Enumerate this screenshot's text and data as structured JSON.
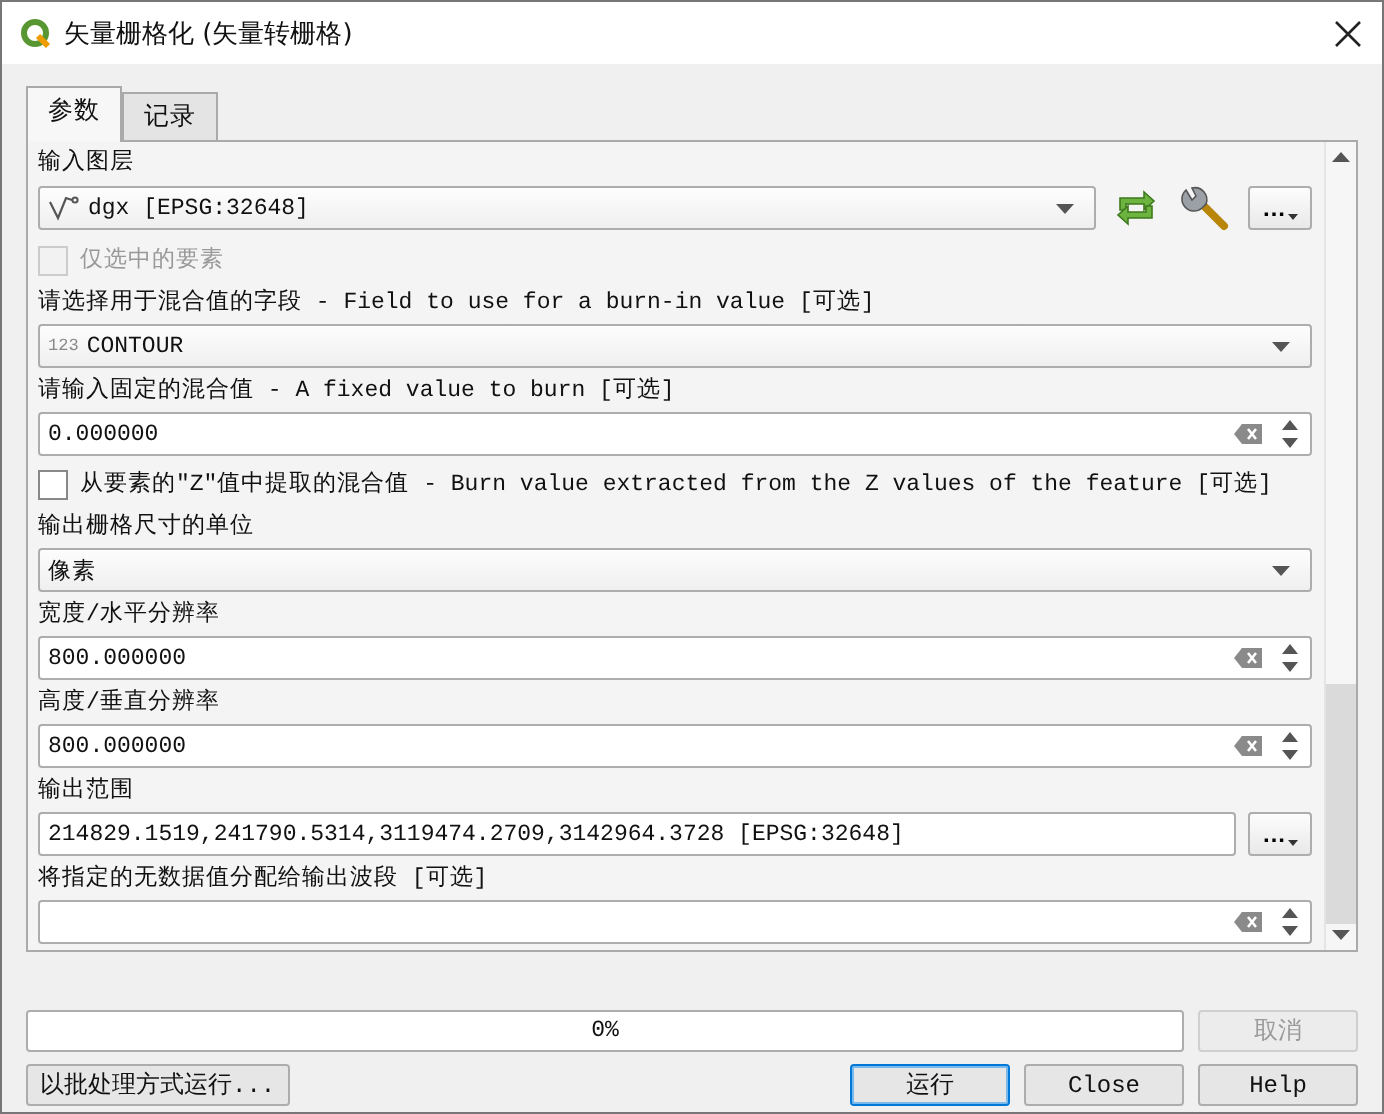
{
  "window": {
    "title": "矢量栅格化 (矢量转栅格)"
  },
  "tabs": [
    {
      "label": "参数",
      "selected": true
    },
    {
      "label": "记录",
      "selected": false
    }
  ],
  "params": [
    {
      "kind": "layer",
      "label": "输入图层",
      "value": "dgx [EPSG:32648]",
      "more": "…"
    },
    {
      "kind": "checkbox",
      "label": "仅选中的要素",
      "checked": false,
      "disabled": true
    },
    {
      "kind": "field",
      "label": "请选择用于混合值的字段 - Field to use for a burn-in value [可选]",
      "type_tag": "123",
      "value": "CONTOUR"
    },
    {
      "kind": "number",
      "label": "请输入固定的混合值 - A fixed value to burn [可选]",
      "value": "0.000000"
    },
    {
      "kind": "checkbox",
      "label": "从要素的\"Z\"值中提取的混合值 - Burn value extracted from the Z values of the feature [可选]",
      "checked": false,
      "disabled": false
    },
    {
      "kind": "select",
      "label": "输出栅格尺寸的单位",
      "value": "像素"
    },
    {
      "kind": "number",
      "label": "宽度/水平分辨率",
      "value": "800.000000"
    },
    {
      "kind": "number",
      "label": "高度/垂直分辨率",
      "value": "800.000000"
    },
    {
      "kind": "extent",
      "label": "输出范围",
      "value": "214829.1519,241790.5314,3119474.2709,3142964.3728 [EPSG:32648]",
      "more": "…"
    },
    {
      "kind": "number",
      "label": "将指定的无数据值分配给输出波段 [可选]"
    }
  ],
  "progress": {
    "text": "0%",
    "level": 0
  },
  "cancel": {
    "label": "取消",
    "disabled": true
  },
  "batch_button": "以批处理方式运行...",
  "buttons": [
    {
      "label": "运行",
      "default": true
    },
    {
      "label": "Close",
      "default": false
    },
    {
      "label": "Help",
      "default": false
    }
  ]
}
